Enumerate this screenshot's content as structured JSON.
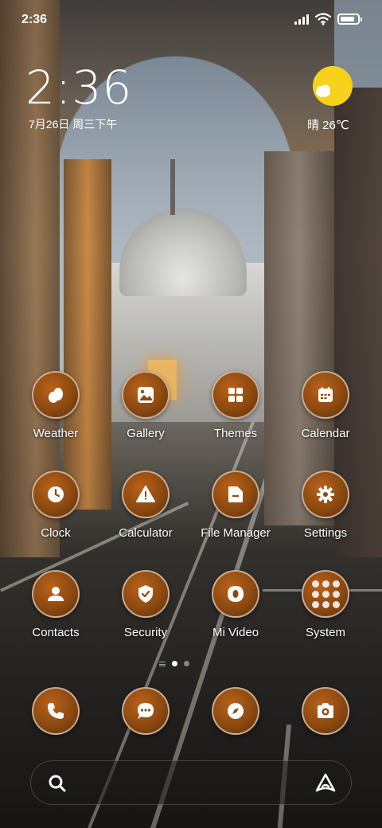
{
  "status_bar": {
    "time": "2:36",
    "signal_bars": 4,
    "wifi": "wifi-icon",
    "battery_level": 0.85
  },
  "clock_widget": {
    "time": "2:36",
    "date": "7月26日 周三下午"
  },
  "weather_widget": {
    "icon": "partly-sunny-icon",
    "text": "晴 26℃"
  },
  "apps": [
    {
      "label": "Weather",
      "icon": "weather-icon"
    },
    {
      "label": "Gallery",
      "icon": "gallery-icon"
    },
    {
      "label": "Themes",
      "icon": "themes-icon"
    },
    {
      "label": "Calendar",
      "icon": "calendar-icon"
    },
    {
      "label": "Clock",
      "icon": "clock-icon"
    },
    {
      "label": "Calculator",
      "icon": "calculator-icon"
    },
    {
      "label": "File Manager",
      "icon": "folder-icon"
    },
    {
      "label": "Settings",
      "icon": "gear-icon"
    },
    {
      "label": "Contacts",
      "icon": "person-icon"
    },
    {
      "label": "Security",
      "icon": "shield-icon"
    },
    {
      "label": "Mi Video",
      "icon": "video-icon"
    },
    {
      "label": "System",
      "icon": "folder-grid-icon"
    }
  ],
  "page_indicator": {
    "pages": 2,
    "active": 1
  },
  "dock": [
    {
      "icon": "phone-icon"
    },
    {
      "icon": "messages-icon"
    },
    {
      "icon": "browser-compass-icon"
    },
    {
      "icon": "camera-icon"
    }
  ],
  "search_bar": {
    "left_icon": "search-icon",
    "right_icon": "assistant-icon"
  },
  "colors": {
    "icon_fill": "#8c4910",
    "icon_highlight": "#b9621b",
    "weather_sun": "#f7d21c"
  }
}
